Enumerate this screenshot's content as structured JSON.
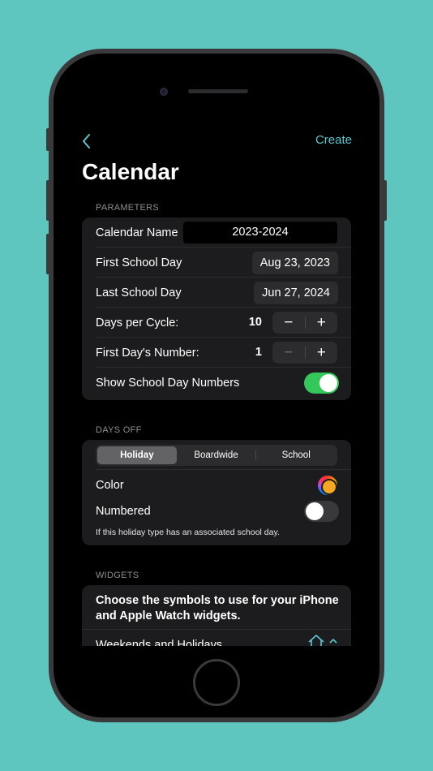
{
  "nav": {
    "create_label": "Create"
  },
  "page": {
    "title": "Calendar"
  },
  "parameters": {
    "section_label": "PARAMETERS",
    "calendar_name_label": "Calendar Name",
    "calendar_name_value": "2023-2024",
    "first_day_label": "First School Day",
    "first_day_value": "Aug 23, 2023",
    "last_day_label": "Last School Day",
    "last_day_value": "Jun 27, 2024",
    "days_per_cycle_label": "Days per Cycle:",
    "days_per_cycle_value": "10",
    "first_day_number_label": "First Day's Number:",
    "first_day_number_value": "1",
    "stepper_minus": "−",
    "stepper_plus": "+",
    "show_numbers_label": "Show School Day Numbers",
    "show_numbers_on": true
  },
  "days_off": {
    "section_label": "DAYS OFF",
    "segments": [
      "Holiday",
      "Boardwide",
      "School"
    ],
    "selected_segment": "Holiday",
    "color_label": "Color",
    "numbered_label": "Numbered",
    "numbered_on": false,
    "note": "If this holiday type has an associated school day."
  },
  "widgets": {
    "section_label": "WIDGETS",
    "description": "Choose the symbols to use for your iPhone and Apple Watch widgets.",
    "weekends_label": "Weekends and Holidays"
  },
  "colors": {
    "accent": "#5ec6d2",
    "toggle_on": "#34c759",
    "background": "#5ec6bf"
  },
  "icons": [
    "back-chevron-icon",
    "house-icon",
    "chevron-up-icon"
  ]
}
